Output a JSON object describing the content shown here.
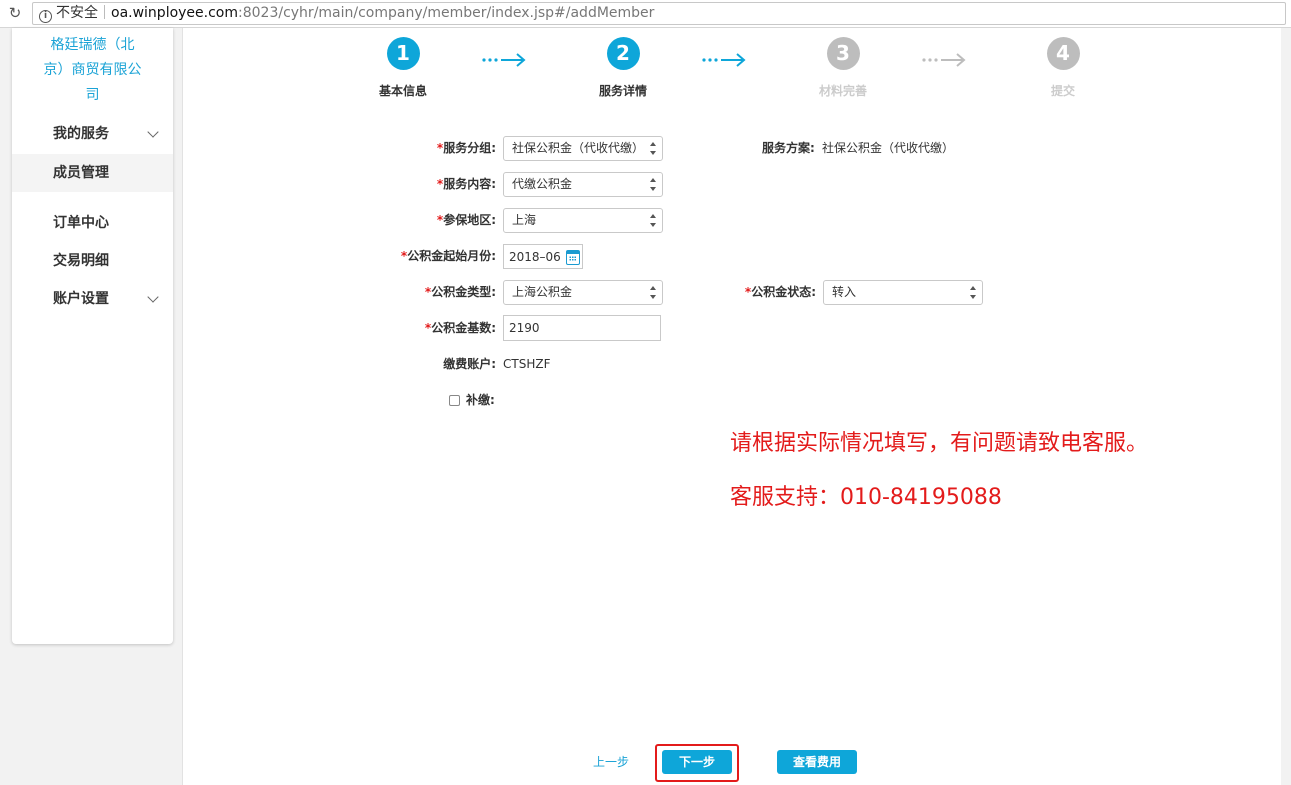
{
  "browser": {
    "security_label": "不安全",
    "url_host": "oa.winployee.com",
    "url_path": ":8023/cyhr/main/company/member/index.jsp#/addMember"
  },
  "sidebar": {
    "company_name": "格廷瑞德（北京）商贸有限公司",
    "items": [
      {
        "label": "我的服务",
        "expandable": true
      },
      {
        "label": "成员管理",
        "active": true
      },
      {
        "label": "订单中心"
      },
      {
        "label": "交易明细"
      },
      {
        "label": "账户设置",
        "expandable": true
      }
    ]
  },
  "steps": [
    {
      "number": "1",
      "label": "基本信息",
      "state": "done"
    },
    {
      "number": "2",
      "label": "服务详情",
      "state": "current"
    },
    {
      "number": "3",
      "label": "材料完善",
      "state": "pending"
    },
    {
      "number": "4",
      "label": "提交",
      "state": "pending"
    }
  ],
  "form": {
    "required_mark": "*",
    "service_group": {
      "label": "服务分组:",
      "value": "社保公积金（代收代缴）"
    },
    "service_plan": {
      "label": "服务方案:",
      "value": "社保公积金（代收代缴）"
    },
    "service_content": {
      "label": "服务内容:",
      "value": "代缴公积金"
    },
    "region": {
      "label": "参保地区:",
      "value": "上海"
    },
    "start_month": {
      "label": "公积金起始月份:",
      "value": "2018–06"
    },
    "fund_type": {
      "label": "公积金类型:",
      "value": "上海公积金"
    },
    "fund_status": {
      "label": "公积金状态:",
      "value": "转入"
    },
    "fund_base": {
      "label": "公积金基数:",
      "value": "2190"
    },
    "payment_account": {
      "label": "缴费账户:",
      "value": "CTSHZF"
    },
    "back_pay": {
      "label": "补缴:"
    }
  },
  "notice": {
    "line1": "请根据实际情况填写，有问题请致电客服。",
    "line2": "客服支持：010-84195088"
  },
  "actions": {
    "prev": "上一步",
    "next": "下一步",
    "view_fee": "查看费用"
  },
  "colors": {
    "accent": "#0ea6d9",
    "alert": "#e31b1b",
    "inactive": "#bdbdbd"
  }
}
